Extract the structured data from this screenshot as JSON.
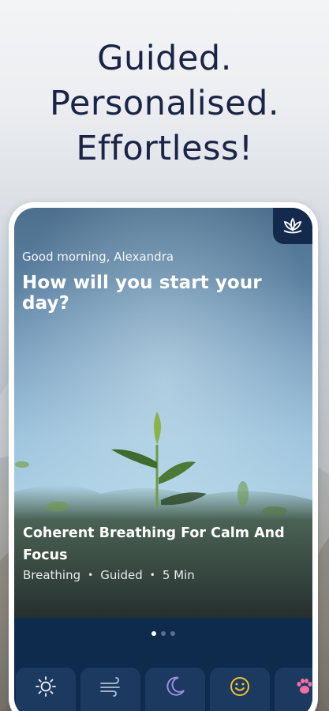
{
  "headline": {
    "line1": "Guided.",
    "line2": "Personalised.",
    "line3": "Effortless!"
  },
  "app": {
    "greeting": "Good morning, Alexandra",
    "question": "How will you start your day?",
    "featured": {
      "title": "Coherent Breathing For Calm And Focus",
      "category": "Breathing",
      "type": "Guided",
      "duration": "5 Min"
    },
    "pager": {
      "count": 3,
      "active": 1
    },
    "tabs": [
      {
        "icon": "sun-icon",
        "label": ""
      },
      {
        "icon": "wind-icon",
        "label": ""
      },
      {
        "icon": "moon-icon",
        "label": ""
      },
      {
        "icon": "smiley-icon",
        "label": ""
      },
      {
        "icon": "paw-icon",
        "label": ""
      }
    ]
  },
  "colors": {
    "headline": "#1b2346",
    "navy": "#0e2a4d",
    "tab_bg": "#1c3a60",
    "moon": "#9c8ce0",
    "smiley": "#f2c230",
    "paw": "#f06fa4"
  }
}
